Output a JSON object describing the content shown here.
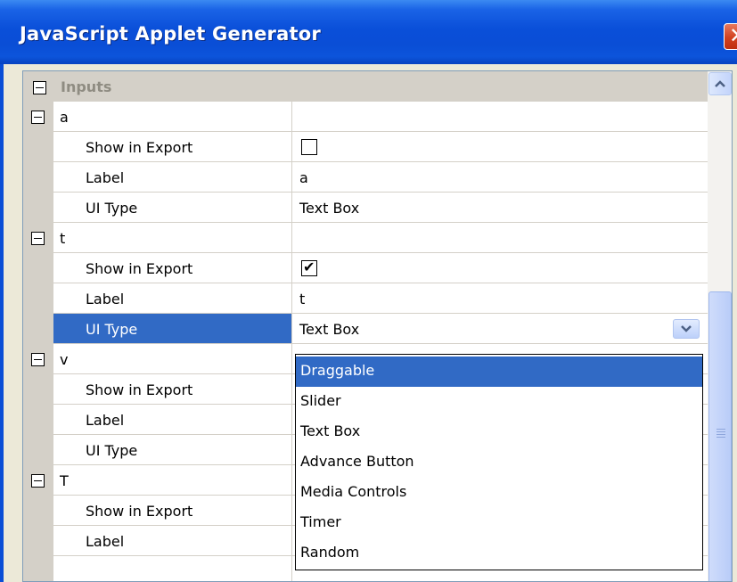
{
  "window": {
    "title": "JavaScript Applet Generator",
    "close_glyph": "✕"
  },
  "grid": {
    "category": {
      "label": "Inputs",
      "icon": "collapse-icon"
    },
    "groups": [
      {
        "name": "a",
        "props": [
          {
            "label": "Show in Export",
            "checked": false
          },
          {
            "label": "Label",
            "value": "a"
          },
          {
            "label": "UI Type",
            "value": "Text Box"
          }
        ]
      },
      {
        "name": "t",
        "props": [
          {
            "label": "Show in Export",
            "checked": true
          },
          {
            "label": "Label",
            "value": "t"
          },
          {
            "label": "UI Type",
            "value": "Text Box",
            "selected": true
          }
        ]
      },
      {
        "name": "v",
        "props": [
          {
            "label": "Show in Export"
          },
          {
            "label": "Label"
          },
          {
            "label": "UI Type"
          }
        ]
      },
      {
        "name": "T",
        "props": [
          {
            "label": "Show in Export"
          },
          {
            "label": "Label"
          }
        ]
      }
    ]
  },
  "dropdown": {
    "options": [
      "Draggable",
      "Slider",
      "Text Box",
      "Advance Button",
      "Media Controls",
      "Timer",
      "Random"
    ],
    "highlighted": "Draggable"
  },
  "colors": {
    "title_bar": "#0a4ed6",
    "selection": "#316ac5",
    "margin": "#d4d0c8"
  },
  "icons": {
    "expander": "minus-box-icon",
    "check": "checkmark-icon",
    "dropdown": "chevron-down-icon",
    "scroll_up": "chevron-up-icon",
    "close": "close-icon"
  }
}
